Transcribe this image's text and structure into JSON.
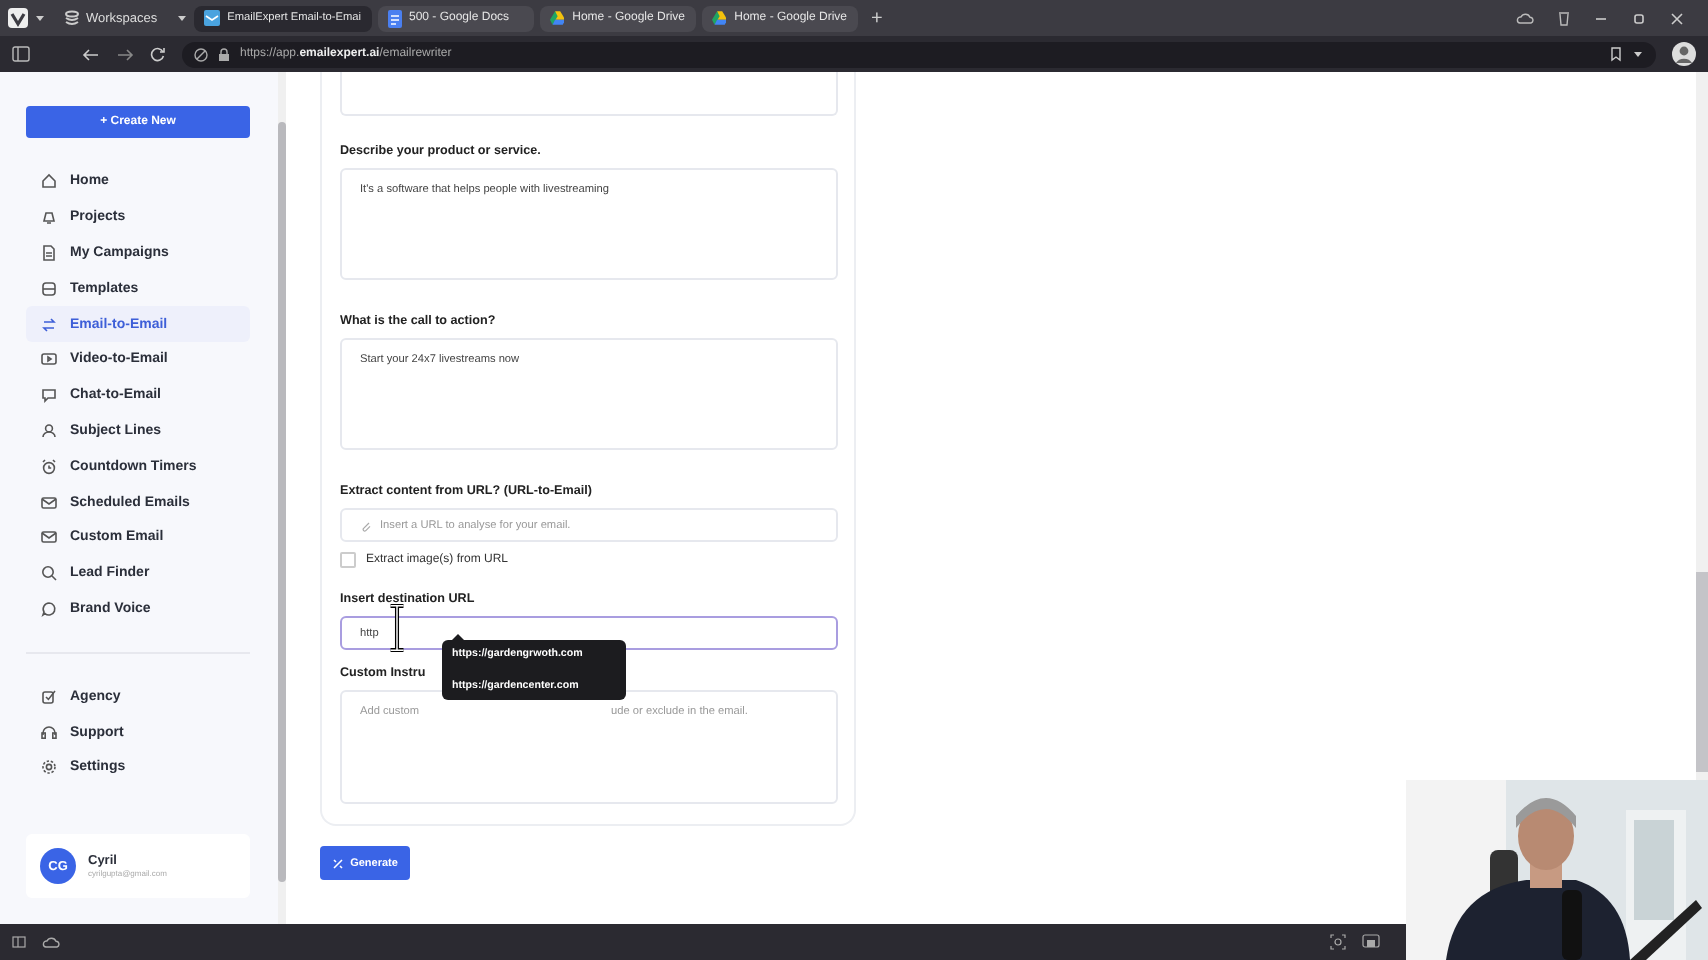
{
  "browser": {
    "workspaces": "Workspaces",
    "tabs": [
      {
        "label": "EmailExpert Email-to-Emai",
        "selected": true
      },
      {
        "label": "500 - Google Docs",
        "selected": false
      },
      {
        "label": "Home - Google Drive",
        "selected": false
      },
      {
        "label": "Home - Google Drive",
        "selected": false
      }
    ],
    "new_tab": "+",
    "url": "https://app.**emailexpert.ai**/emailrewriter"
  },
  "sidebar": {
    "create_button": "+ Create New",
    "items": [
      {
        "label": "Home",
        "selected": false
      },
      {
        "label": "Projects",
        "selected": false
      },
      {
        "label": "My Campaigns",
        "selected": false
      },
      {
        "label": "Templates",
        "selected": false
      },
      {
        "label": "Email-to-Email",
        "selected": true
      },
      {
        "label": "Video-to-Email",
        "selected": false
      },
      {
        "label": "Chat-to-Email",
        "selected": false
      },
      {
        "label": "Subject Lines",
        "selected": false
      },
      {
        "label": "Countdown Timers",
        "selected": false
      },
      {
        "label": "Scheduled Emails",
        "selected": false
      },
      {
        "label": "Custom Email",
        "selected": false
      },
      {
        "label": "Lead Finder",
        "selected": false
      },
      {
        "label": "Brand Voice",
        "selected": false
      }
    ],
    "bottom_items": [
      {
        "label": "Agency",
        "selected": false
      },
      {
        "label": "Support",
        "selected": false
      },
      {
        "label": "Settings",
        "selected": false
      }
    ],
    "user": {
      "initials": "CG",
      "name": "Cyril",
      "email": "cyrilgupta@gmail.com"
    }
  },
  "form": {
    "product_label": "Describe your product or service.",
    "product_value": "It's a software that helps people with livestreaming",
    "cta_label": "What is the call to action?",
    "cta_value": "Start your 24x7 livestreams now",
    "extract_label": "Extract content from URL? (URL-to-Email)",
    "extract_placeholder": "Insert a URL to analyse for your email.",
    "extract_images": {
      "label": "Extract image(s) from URL",
      "checked": false
    },
    "destination_label": "Insert destination URL",
    "destination_value": "http",
    "suggestions": [
      "https://gardengrwoth.com",
      "https://gardencenter.com"
    ],
    "custom_label": "Custom Instru",
    "custom_placeholder_start": "Add custom",
    "custom_placeholder_end": "ude or exclude in the email.",
    "generate_button": "Generate"
  }
}
